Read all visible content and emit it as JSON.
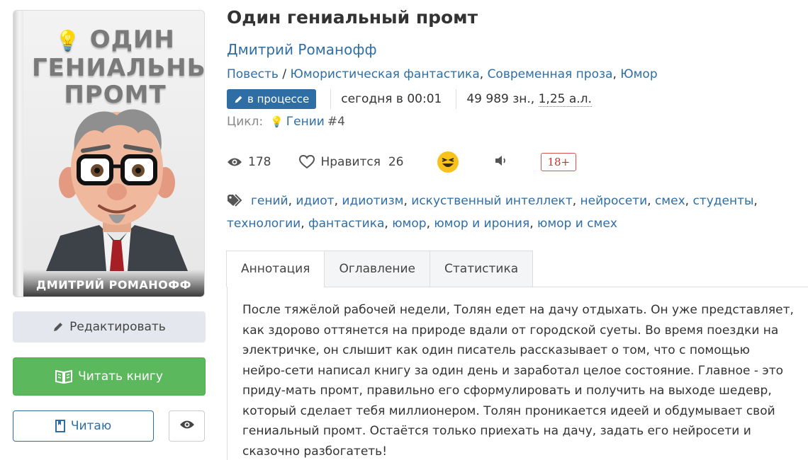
{
  "cover": {
    "title_lines": [
      "ОДИН",
      "ГЕНИАЛЬНЫЙ",
      "ПРОМТ"
    ],
    "author": "ДМИТРИЙ РОМАНОФФ"
  },
  "book": {
    "title": "Один гениальный промт",
    "author": "Дмитрий Романофф",
    "form": "Повесть",
    "genres_sep": "/",
    "genres": [
      "Юмористическая фантастика",
      "Современная проза",
      "Юмор"
    ],
    "status": "в процессе",
    "updated": "сегодня в 00:01",
    "size_chars": "49 989 зн.,",
    "size_sheets": "1,25 а.л.",
    "cycle_label": "Цикл:",
    "cycle_name": "Гении",
    "cycle_number": "#4"
  },
  "stats": {
    "views": "178",
    "likes_label": "Нравится",
    "likes": "26",
    "age_rating": "18+"
  },
  "tags": [
    "гений",
    "идиот",
    "идиотизм",
    "искуственный интеллект",
    "нейросети",
    "смех",
    "студенты",
    "технологии",
    "фантастика",
    "юмор",
    "юмор и ирония",
    "юмор и смех"
  ],
  "tabs": [
    "Аннотация",
    "Оглавление",
    "Статистика"
  ],
  "annotation": "После тяжёлой рабочей недели, Толян едет на дачу отдыхать. Он уже представляет, как здорово оттянется на природе вдали от городской суеты. Во время поездки на электричке, он слышит как один писатель рассказывает о том, что с помощью нейро-сети написал книгу за один день и заработал целое состояние. Главное - это приду-мать промт, правильно его сформулировать и получить на выходе шедевр, который сделает тебя миллионером. Толян проникается идеей и обдумывает свой гениальный промт. Остаётся только приехать на дачу, задать его нейросети и сказочно разбогатеть!",
  "buttons": {
    "edit": "Редактировать",
    "read": "Читать книгу",
    "reading": "Читаю"
  },
  "colors": {
    "link": "#2f6ea5",
    "read_button": "#5cb85c",
    "status_badge": "#2f6ea5",
    "age_badge": "#d9534f"
  }
}
